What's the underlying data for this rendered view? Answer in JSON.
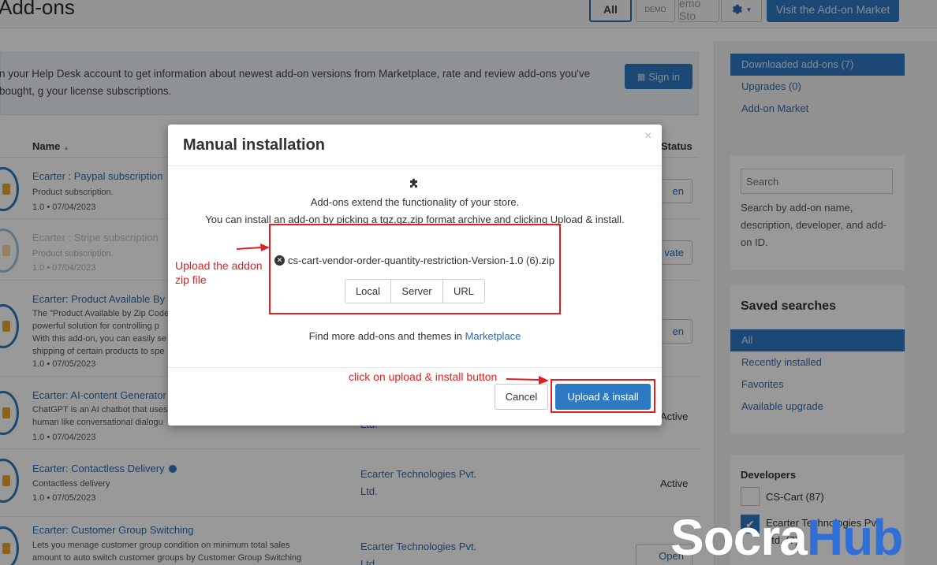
{
  "header": {
    "title": "Add-ons",
    "tabs": {
      "all": "All",
      "demo": "DEMO",
      "store": "emo Sto"
    },
    "market_button": "Visit the Add-on Market"
  },
  "notice": {
    "text": "n your Help Desk account to get information about newest add-on versions from Marketplace, rate and review add-ons you've bought, g your license subscriptions.",
    "signin_label": "Sign in"
  },
  "table": {
    "col_name": "Name",
    "col_status": "Status",
    "rows": [
      {
        "title": "Ecarter : Paypal subscription",
        "desc": "Product subscription.",
        "meta": "1.0 • 07/04/2023",
        "developer": "",
        "status": "",
        "button": "en"
      },
      {
        "title": "Ecarter : Stripe subscription",
        "desc": "Product subscription.",
        "meta": "1.0 • 07/04/2023",
        "developer": "",
        "status": "",
        "button": "vate"
      },
      {
        "title": "Ecarter: Product Available By",
        "desc": "The \"Product Available by Zip Code powerful solution for controlling p With this add-on, you can easily se shipping of certain products to spe",
        "meta": "1.0 • 07/05/2023",
        "developer": "",
        "status": "",
        "button": "en"
      },
      {
        "title": "Ecarter: AI-content Generator",
        "desc": "ChatGPT is an AI chatbot that uses human like conversational dialogu",
        "meta": "1.0 • 07/04/2023",
        "developer": "Ltd.",
        "status": "Active",
        "button": ""
      },
      {
        "title": "Ecarter: Contactless Delivery",
        "desc": "Contactless delivery",
        "meta": "1.0 • 07/05/2023",
        "developer": "Ecarter Technologies Pvt. Ltd.",
        "status": "Active",
        "button": ""
      },
      {
        "title": "Ecarter: Customer Group Switching",
        "desc": "Lets you menage customer group condition on minimum total sales amount to auto switch customer groups by Customer Group Switching",
        "meta": "",
        "developer": "Ecarter Technologies Pvt. Ltd.",
        "status": "",
        "button": "Open"
      }
    ]
  },
  "sidebar": {
    "nav": [
      "Downloaded add-ons (7)",
      "Upgrades (0)",
      "Add-on Market"
    ],
    "search_placeholder": "Search",
    "search_help": "Search by add-on name, description, developer, and add-on ID.",
    "saved_title": "Saved searches",
    "saved": [
      "All",
      "Recently installed",
      "Favorites",
      "Available upgrade"
    ],
    "developers_title": "Developers",
    "developers": [
      {
        "name": "CS-Cart (87)",
        "checked": false
      },
      {
        "name": "Ecarter Technologies Pvt. Ltd. (7)",
        "checked": true
      }
    ]
  },
  "modal": {
    "title": "Manual installation",
    "close": "×",
    "line1": "Add-ons extend the functionality of your store.",
    "line2": "You can install an add-on by picking a tgz,gz,zip format archive and clicking Upload & install.",
    "file_name": "cs-cart-vendor-order-quantity-restriction-Version-1.0 (6).zip",
    "sources": [
      "Local",
      "Server",
      "URL"
    ],
    "find_more": "Find more add-ons and themes in",
    "marketplace_link": "Marketplace",
    "cancel": "Cancel",
    "install": "Upload & install"
  },
  "annotations": {
    "upload": "Upload the addon zip file",
    "click": "click on upload & install button"
  },
  "watermark": {
    "part1": "Socra",
    "part2": "Hub"
  },
  "colors": {
    "accent": "#2e79c3",
    "annotation": "#e02020",
    "link": "#2b6cb0"
  }
}
